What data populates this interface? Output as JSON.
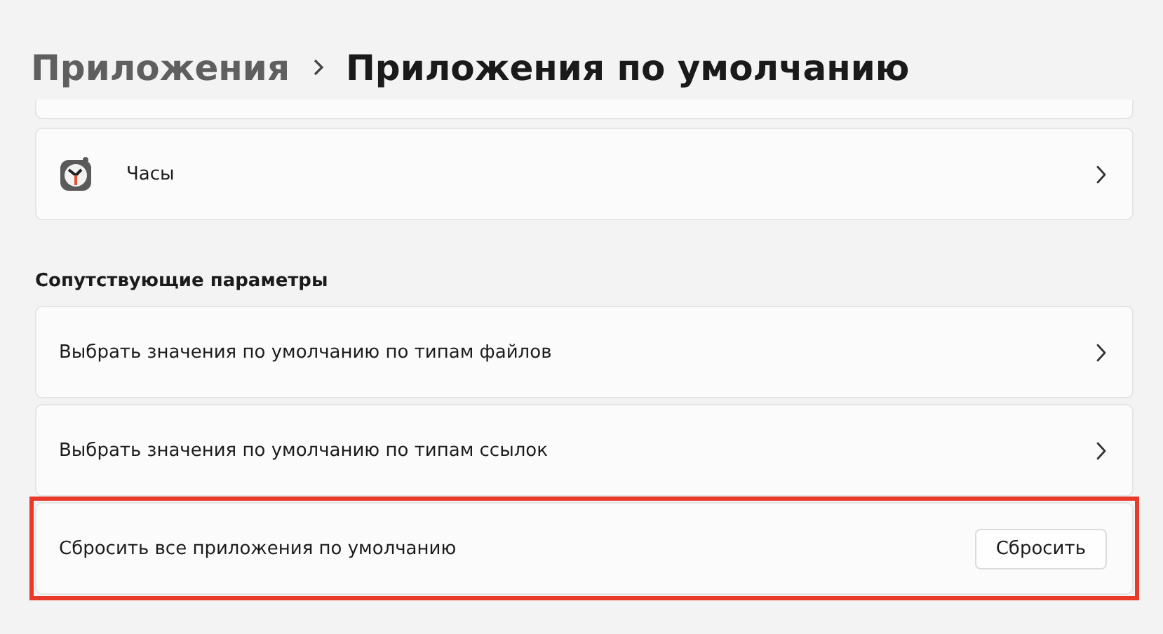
{
  "breadcrumb": {
    "parent": "Приложения",
    "current": "Приложения по умолчанию"
  },
  "apps": [
    {
      "name": "Часы"
    }
  ],
  "related_settings": {
    "title": "Сопутствующие параметры",
    "items": [
      {
        "kind": "link",
        "label": "Выбрать значения по умолчанию по типам файлов",
        "highlighted": false
      },
      {
        "kind": "link",
        "label": "Выбрать значения по умолчанию по типам ссылок",
        "highlighted": false
      },
      {
        "kind": "action",
        "label": "Сбросить все приложения по умолчанию",
        "button": "Сбросить",
        "highlighted": true
      }
    ]
  }
}
